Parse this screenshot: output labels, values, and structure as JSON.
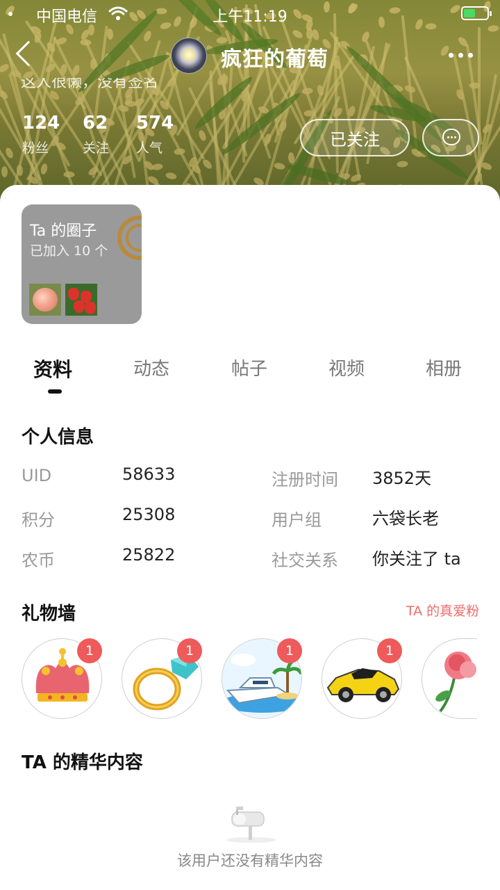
{
  "status_bar": {
    "carrier": "中国电信",
    "time": "上午11:19"
  },
  "header": {
    "username": "疯狂的葡萄",
    "bio": "这人很懒，没有签名"
  },
  "stats": [
    {
      "value": "124",
      "label": "粉丝"
    },
    {
      "value": "62",
      "label": "关注"
    },
    {
      "value": "574",
      "label": "人气"
    }
  ],
  "actions": {
    "follow_label": "已关注"
  },
  "circle": {
    "title": "Ta 的圈子",
    "subtitle": "已加入 10 个"
  },
  "tabs": [
    "资料",
    "动态",
    "帖子",
    "视频",
    "相册"
  ],
  "active_tab": "资料",
  "personal_info": {
    "title": "个人信息",
    "rows": [
      {
        "label": "UID",
        "value": "58633"
      },
      {
        "label": "积分",
        "value": "25308"
      },
      {
        "label": "农币",
        "value": "25822"
      },
      {
        "label": "注册时间",
        "value": "3852天"
      },
      {
        "label": "用户组",
        "value": "六袋长老"
      },
      {
        "label": "社交关系",
        "value": "你关注了 ta"
      }
    ]
  },
  "gift_wall": {
    "title": "礼物墙",
    "link": "TA 的真爱粉",
    "gifts": [
      {
        "name": "crown-icon",
        "count": "1"
      },
      {
        "name": "diamond-ring-icon",
        "count": "1"
      },
      {
        "name": "yacht-icon",
        "count": "1"
      },
      {
        "name": "sports-car-icon",
        "count": "1"
      },
      {
        "name": "rose-icon"
      }
    ]
  },
  "featured": {
    "title": "TA 的精华内容",
    "empty_text": "该用户还没有精华内容"
  },
  "colors": {
    "accent_red": "#ef5a5a",
    "fans_link": "#f06a6a",
    "circle_card_bg": "#9a9a9a"
  }
}
